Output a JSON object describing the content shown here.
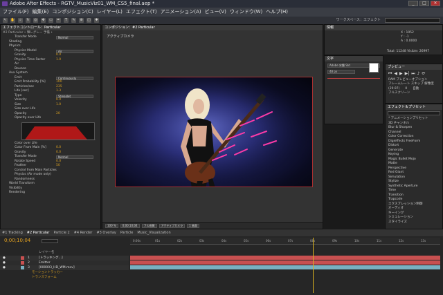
{
  "window": {
    "title": "Adobe After Effects - RGTV_MusicViz01_WM_CS5_final.aep *",
    "minimize": "_",
    "maximize": "□",
    "close": "✕"
  },
  "menu": [
    "ファイル(F)",
    "編集(E)",
    "コンポジション(C)",
    "レイヤー(L)",
    "エフェクト(T)",
    "アニメーション(A)",
    "ビュー(V)",
    "ウィンドウ(W)",
    "ヘルプ(H)"
  ],
  "toolbar": {
    "workspace": "ワークスペース：エフェクト"
  },
  "effects_panel": {
    "tab": "エフェクトコントロール：Particular",
    "header": "#2 Particular • 輝レグレー 予備 •",
    "rows": [
      {
        "label": "Transfer Mode",
        "indent": 2,
        "dropdown": "Normal"
      },
      {
        "label": "Shading",
        "indent": 1
      },
      {
        "label": "Physics",
        "indent": 1
      },
      {
        "label": "Physics Model",
        "indent": 2,
        "dropdown": "Air"
      },
      {
        "label": "Gravity",
        "indent": 2,
        "value": "0.0"
      },
      {
        "label": "Physics Time Factor",
        "indent": 2,
        "value": "1.0"
      },
      {
        "label": "Air",
        "indent": 2
      },
      {
        "label": "Bounce",
        "indent": 2
      },
      {
        "label": "Aux System",
        "indent": 1
      },
      {
        "label": "Emit",
        "indent": 2,
        "dropdown": "Continuously"
      },
      {
        "label": "Emit Probability [%]",
        "indent": 2,
        "value": "100"
      },
      {
        "label": "Particles/sec",
        "indent": 2,
        "value": "235"
      },
      {
        "label": "Life [sec]",
        "indent": 2,
        "value": "1.3"
      },
      {
        "label": "Type",
        "indent": 2,
        "dropdown": "Streaklet"
      },
      {
        "label": "Velocity",
        "indent": 2,
        "value": "0.0"
      },
      {
        "label": "Size",
        "indent": 2,
        "value": "1.0"
      },
      {
        "label": "Size over Life",
        "indent": 2
      },
      {
        "label": "Opacity",
        "indent": 2,
        "value": "20"
      },
      {
        "label": "Opacity over Life",
        "indent": 2
      }
    ],
    "rows2": [
      {
        "label": "Color over Life",
        "indent": 2
      },
      {
        "label": "Color From Main [%]",
        "indent": 2,
        "value": "0.0"
      },
      {
        "label": "Gravity",
        "indent": 2,
        "value": "0.0"
      },
      {
        "label": "Transfer Mode",
        "indent": 2,
        "dropdown": "Normal"
      },
      {
        "label": "Rotate Speed",
        "indent": 2,
        "value": "0.0"
      },
      {
        "label": "Feather",
        "indent": 2,
        "value": "50"
      },
      {
        "label": "Control from Main Particles",
        "indent": 2
      },
      {
        "label": "Physics (Air mode only)",
        "indent": 2
      },
      {
        "label": "Randomness",
        "indent": 2
      },
      {
        "label": "World Transform",
        "indent": 1
      },
      {
        "label": "Visibility",
        "indent": 1
      },
      {
        "label": "Rendering",
        "indent": 1
      }
    ]
  },
  "comp_panel": {
    "tab": "コンポジション：#2 Particular",
    "label": "アクティブカメラ",
    "viewer_bar": [
      "100 %",
      "0;00;10;04",
      "フル画質",
      "アクティブカメラ",
      "1 画面"
    ]
  },
  "info_panel": {
    "tab": "情報",
    "lines": [
      "X : 1052",
      "Y : -1",
      "A : 0.0000",
      "Total: 11248  Visible: 26997"
    ]
  },
  "char_panel": {
    "tab": "文字",
    "font": "Adobe 宋體 Std",
    "size": "48 px"
  },
  "preview_panel": {
    "tab": "プレビュー",
    "opt1": "RAM プレビューオプション",
    "opt2": "フレームレート  スキップ  解像度",
    "fps": "(29.97)",
    "skip": "0",
    "res": "自動",
    "full": "フルスクリーン"
  },
  "effect_list": {
    "tab": "エフェクト＆プリセット",
    "items": [
      "* アニメーションプリセット",
      "3D チャンネル",
      "Blur & Sharpen",
      "Channel",
      "Color Correction",
      "Digieffects FreeForm",
      "Distort",
      "Generate",
      "Keying",
      "Magic Bullet Mojo",
      "Matte",
      "Perspective",
      "Red Giant",
      "Simulation",
      "Stylize",
      "Synthetic Aperture",
      "Time",
      "Transition",
      "Trapcode",
      "エクスプレッション制御",
      "オーディオ",
      "キーイング",
      "シミュレーション",
      "スタイライズ"
    ]
  },
  "timeline": {
    "tabs": [
      "#1 Tracking",
      "#2 Particular",
      "Particle 2",
      "#4 Render",
      "#3 Overlay",
      "Particle",
      "Music_Visualization"
    ],
    "timecode": "0;00;10;04",
    "layers_header": "レイヤー名",
    "layers": [
      {
        "num": "1",
        "name": "[トラッキング...]",
        "color": "#c85050"
      },
      {
        "num": "2",
        "name": "Emitter",
        "color": "#c85050"
      },
      {
        "num": "3",
        "name": "[000003_HD_WM.mov]",
        "color": "#7ab0c0"
      }
    ],
    "sub_rows": [
      "モーショントラッカー",
      "トランスフォーム"
    ],
    "ticks": [
      "0:00s",
      "01s",
      "02s",
      "03s",
      "04s",
      "05s",
      "06s",
      "07s",
      "08s",
      "09s",
      "10s",
      "11s",
      "12s",
      "13s"
    ]
  }
}
